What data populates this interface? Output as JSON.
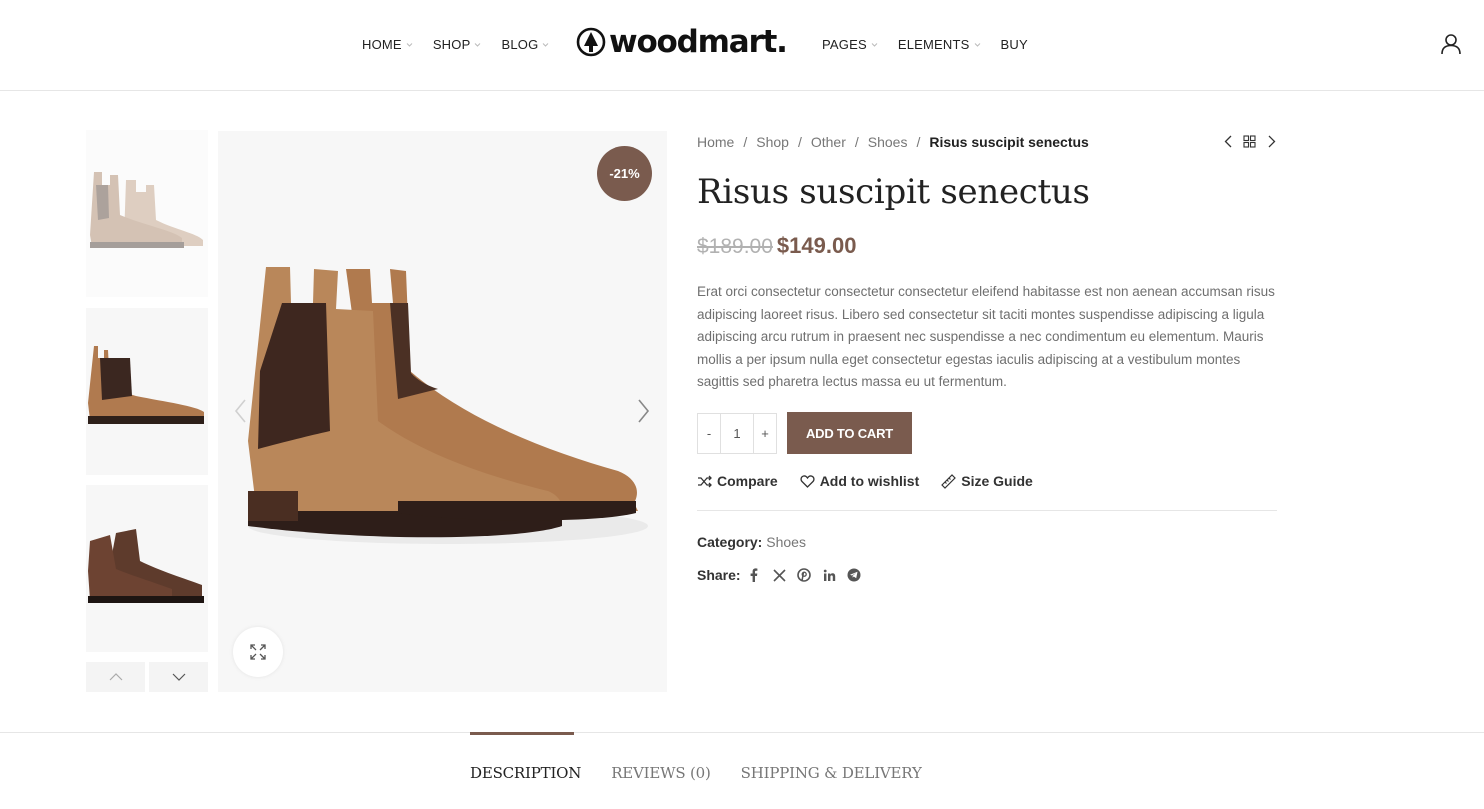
{
  "header": {
    "nav_left": [
      {
        "label": "HOME",
        "has_dropdown": true
      },
      {
        "label": "SHOP",
        "has_dropdown": true
      },
      {
        "label": "BLOG",
        "has_dropdown": true
      }
    ],
    "logo_text": "woodmart.",
    "nav_right": [
      {
        "label": "PAGES",
        "has_dropdown": true
      },
      {
        "label": "ELEMENTS",
        "has_dropdown": true
      },
      {
        "label": "BUY",
        "has_dropdown": false
      }
    ],
    "user_icon": "user-icon"
  },
  "gallery": {
    "badge": "-21%",
    "thumbnails": [
      "chelsea-boot-tan-faded",
      "chelsea-boot-tan",
      "lace-up-boot-brown"
    ],
    "active_thumbnail": 1
  },
  "breadcrumb": {
    "items": [
      "Home",
      "Shop",
      "Other",
      "Shoes"
    ],
    "separator": "/",
    "current": "Risus suscipit senectus"
  },
  "product": {
    "title": "Risus suscipit senectus",
    "price_old": "$189.00",
    "price_new": "$149.00",
    "description": "Erat orci consectetur consectetur consectetur eleifend habitasse est non aenean accumsan risus adipiscing laoreet risus. Libero sed consectetur sit taciti montes suspendisse adipiscing a ligula adipiscing arcu rutrum in praesent nec suspendisse a nec condimentum eu elementum. Mauris mollis a per ipsum nulla eget consectetur egestas iaculis adipiscing at a vestibulum montes sagittis sed pharetra lectus massa eu ut fermentum.",
    "quantity": "1",
    "qty_minus": "-",
    "qty_plus": "+",
    "add_to_cart": "ADD TO CART",
    "actions": {
      "compare": "Compare",
      "wishlist": "Add to wishlist",
      "size_guide": "Size Guide"
    },
    "category_label": "Category:",
    "category_value": "Shoes",
    "share_label": "Share:",
    "share_icons": [
      "facebook-icon",
      "x-icon",
      "pinterest-icon",
      "linkedin-icon",
      "telegram-icon"
    ]
  },
  "tabs": [
    {
      "label": "DESCRIPTION",
      "active": true
    },
    {
      "label": "REVIEWS (0)",
      "active": false
    },
    {
      "label": "SHIPPING & DELIVERY",
      "active": false
    }
  ],
  "colors": {
    "accent": "#7a5b4e",
    "text": "#222222",
    "muted": "#777777",
    "price_old": "#b1b1b1"
  }
}
